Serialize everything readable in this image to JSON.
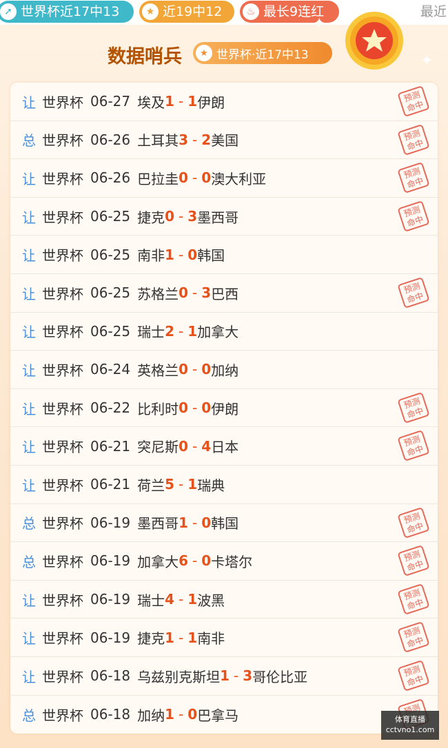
{
  "top_bar": {
    "pill1": "世界杯近17中13",
    "pill2": "近19中12",
    "pill3": "最长9连红",
    "pill4": "最近"
  },
  "header": {
    "title": "数据哨兵",
    "badge": "世界杯·近17中13"
  },
  "stamp_text": "预测命中",
  "matches": [
    {
      "tag": "让",
      "league": "世界杯",
      "date": "06-27",
      "home": "埃及",
      "hs": "1",
      "as": "1",
      "away": "伊朗",
      "hit": true
    },
    {
      "tag": "总",
      "league": "世界杯",
      "date": "06-26",
      "home": "土耳其",
      "hs": "3",
      "as": "2",
      "away": "美国",
      "hit": true
    },
    {
      "tag": "让",
      "league": "世界杯",
      "date": "06-26",
      "home": "巴拉圭",
      "hs": "0",
      "as": "0",
      "away": "澳大利亚",
      "hit": true
    },
    {
      "tag": "让",
      "league": "世界杯",
      "date": "06-25",
      "home": "捷克",
      "hs": "0",
      "as": "3",
      "away": "墨西哥",
      "hit": true
    },
    {
      "tag": "让",
      "league": "世界杯",
      "date": "06-25",
      "home": "南非",
      "hs": "1",
      "as": "0",
      "away": "韩国",
      "hit": false
    },
    {
      "tag": "让",
      "league": "世界杯",
      "date": "06-25",
      "home": "苏格兰",
      "hs": "0",
      "as": "3",
      "away": "巴西",
      "hit": true
    },
    {
      "tag": "让",
      "league": "世界杯",
      "date": "06-25",
      "home": "瑞士",
      "hs": "2",
      "as": "1",
      "away": "加拿大",
      "hit": false
    },
    {
      "tag": "让",
      "league": "世界杯",
      "date": "06-24",
      "home": "英格兰",
      "hs": "0",
      "as": "0",
      "away": "加纳",
      "hit": false
    },
    {
      "tag": "让",
      "league": "世界杯",
      "date": "06-22",
      "home": "比利时",
      "hs": "0",
      "as": "0",
      "away": "伊朗",
      "hit": true
    },
    {
      "tag": "让",
      "league": "世界杯",
      "date": "06-21",
      "home": "突尼斯",
      "hs": "0",
      "as": "4",
      "away": "日本",
      "hit": true
    },
    {
      "tag": "让",
      "league": "世界杯",
      "date": "06-21",
      "home": "荷兰",
      "hs": "5",
      "as": "1",
      "away": "瑞典",
      "hit": false
    },
    {
      "tag": "总",
      "league": "世界杯",
      "date": "06-19",
      "home": "墨西哥",
      "hs": "1",
      "as": "0",
      "away": "韩国",
      "hit": true
    },
    {
      "tag": "总",
      "league": "世界杯",
      "date": "06-19",
      "home": "加拿大",
      "hs": "6",
      "as": "0",
      "away": "卡塔尔",
      "hit": true
    },
    {
      "tag": "让",
      "league": "世界杯",
      "date": "06-19",
      "home": "瑞士",
      "hs": "4",
      "as": "1",
      "away": "波黑",
      "hit": true
    },
    {
      "tag": "让",
      "league": "世界杯",
      "date": "06-19",
      "home": "捷克",
      "hs": "1",
      "as": "1",
      "away": "南非",
      "hit": true
    },
    {
      "tag": "让",
      "league": "世界杯",
      "date": "06-18",
      "home": "乌兹别克斯坦",
      "hs": "1",
      "as": "3",
      "away": "哥伦比亚",
      "hit": true
    },
    {
      "tag": "总",
      "league": "世界杯",
      "date": "06-18",
      "home": "加纳",
      "hs": "1",
      "as": "0",
      "away": "巴拿马",
      "hit": true
    }
  ],
  "watermark": {
    "line1": "体育直播",
    "line2": "cctvno1.com"
  }
}
